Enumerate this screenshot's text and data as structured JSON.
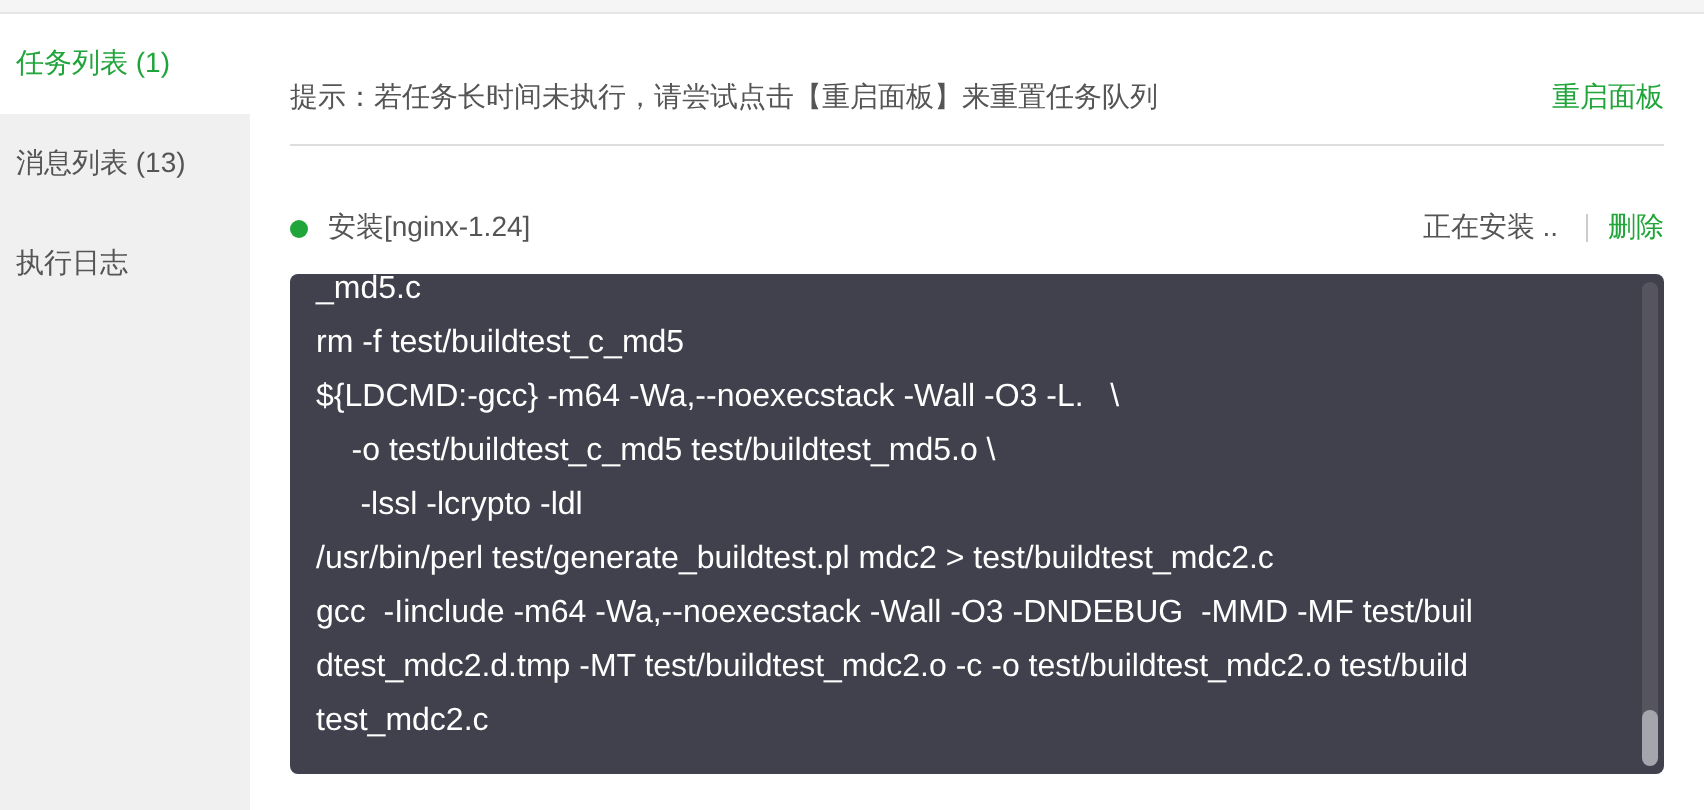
{
  "sidebar": {
    "items": [
      {
        "label": "任务列表 (1)",
        "selected": true
      },
      {
        "label": "消息列表 (13)",
        "selected": false
      },
      {
        "label": "执行日志",
        "selected": false
      }
    ]
  },
  "hint": {
    "text": "提示：若任务长时间未执行，请尝试点击【重启面板】来重置任务队列",
    "action": "重启面板"
  },
  "task": {
    "name": "安装[nginx-1.24]",
    "color": "#20a53a",
    "status": "正在安装 ..",
    "action": "删除"
  },
  "log": {
    "lines": [
      "_md5.c",
      "rm -f test/buildtest_c_md5",
      "${LDCMD:-gcc} -m64 -Wa,--noexecstack -Wall -O3 -L.   \\",
      "    -o test/buildtest_c_md5 test/buildtest_md5.o \\",
      "     -lssl -lcrypto -ldl",
      "/usr/bin/perl test/generate_buildtest.pl mdc2 > test/buildtest_mdc2.c",
      "gcc  -Iinclude -m64 -Wa,--noexecstack -Wall -O3 -DNDEBUG  -MMD -MF test/buil",
      "dtest_mdc2.d.tmp -MT test/buildtest_mdc2.o -c -o test/buildtest_mdc2.o test/build",
      "test_mdc2.c"
    ]
  }
}
